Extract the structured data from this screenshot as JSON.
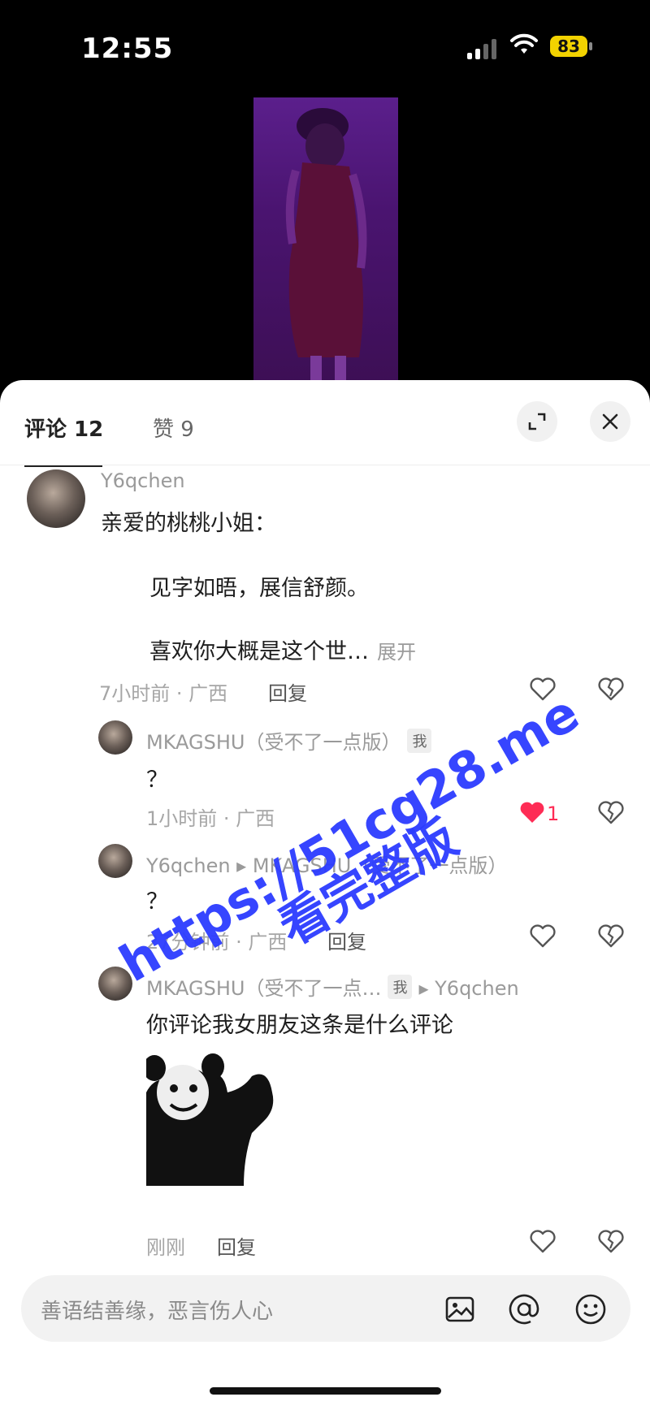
{
  "status_bar": {
    "time": "12:55",
    "battery": "83"
  },
  "tabs": [
    {
      "label": "评论 12"
    },
    {
      "label": "赞 9"
    }
  ],
  "comments": [
    {
      "username": "Y6qchen",
      "lines": [
        "亲爱的桃桃小姐：",
        "见字如晤，展信舒颜。",
        "喜欢你大概是这个世…"
      ],
      "expand": "展开",
      "meta": "7小时前 · 广西",
      "reply": "回复"
    },
    {
      "username": "MKAGSHU（受不了一点版）",
      "badge": "我",
      "text": "？",
      "meta": "1小时前 · 广西",
      "likes": "1"
    },
    {
      "username": "Y6qchen ▸ MKAGSHU（受不了一点版）",
      "text": "？",
      "meta": "27分钟前 · 广西",
      "reply": "回复"
    },
    {
      "username": "MKAGSHU（受不了一点…",
      "badge": "我",
      "reply_to": "▸ Y6qchen",
      "text": "你评论我女朋友这条是什么评论",
      "meta": "刚刚",
      "reply": "回复"
    }
  ],
  "input": {
    "placeholder": "善语结善缘，恶言伤人心"
  },
  "watermark": {
    "line1": "https://51cg28.me",
    "line2": "看完整版"
  },
  "colors": {
    "accent_like": "#fe2c55",
    "watermark": "#2c3cff",
    "battery": "#f2d200"
  }
}
